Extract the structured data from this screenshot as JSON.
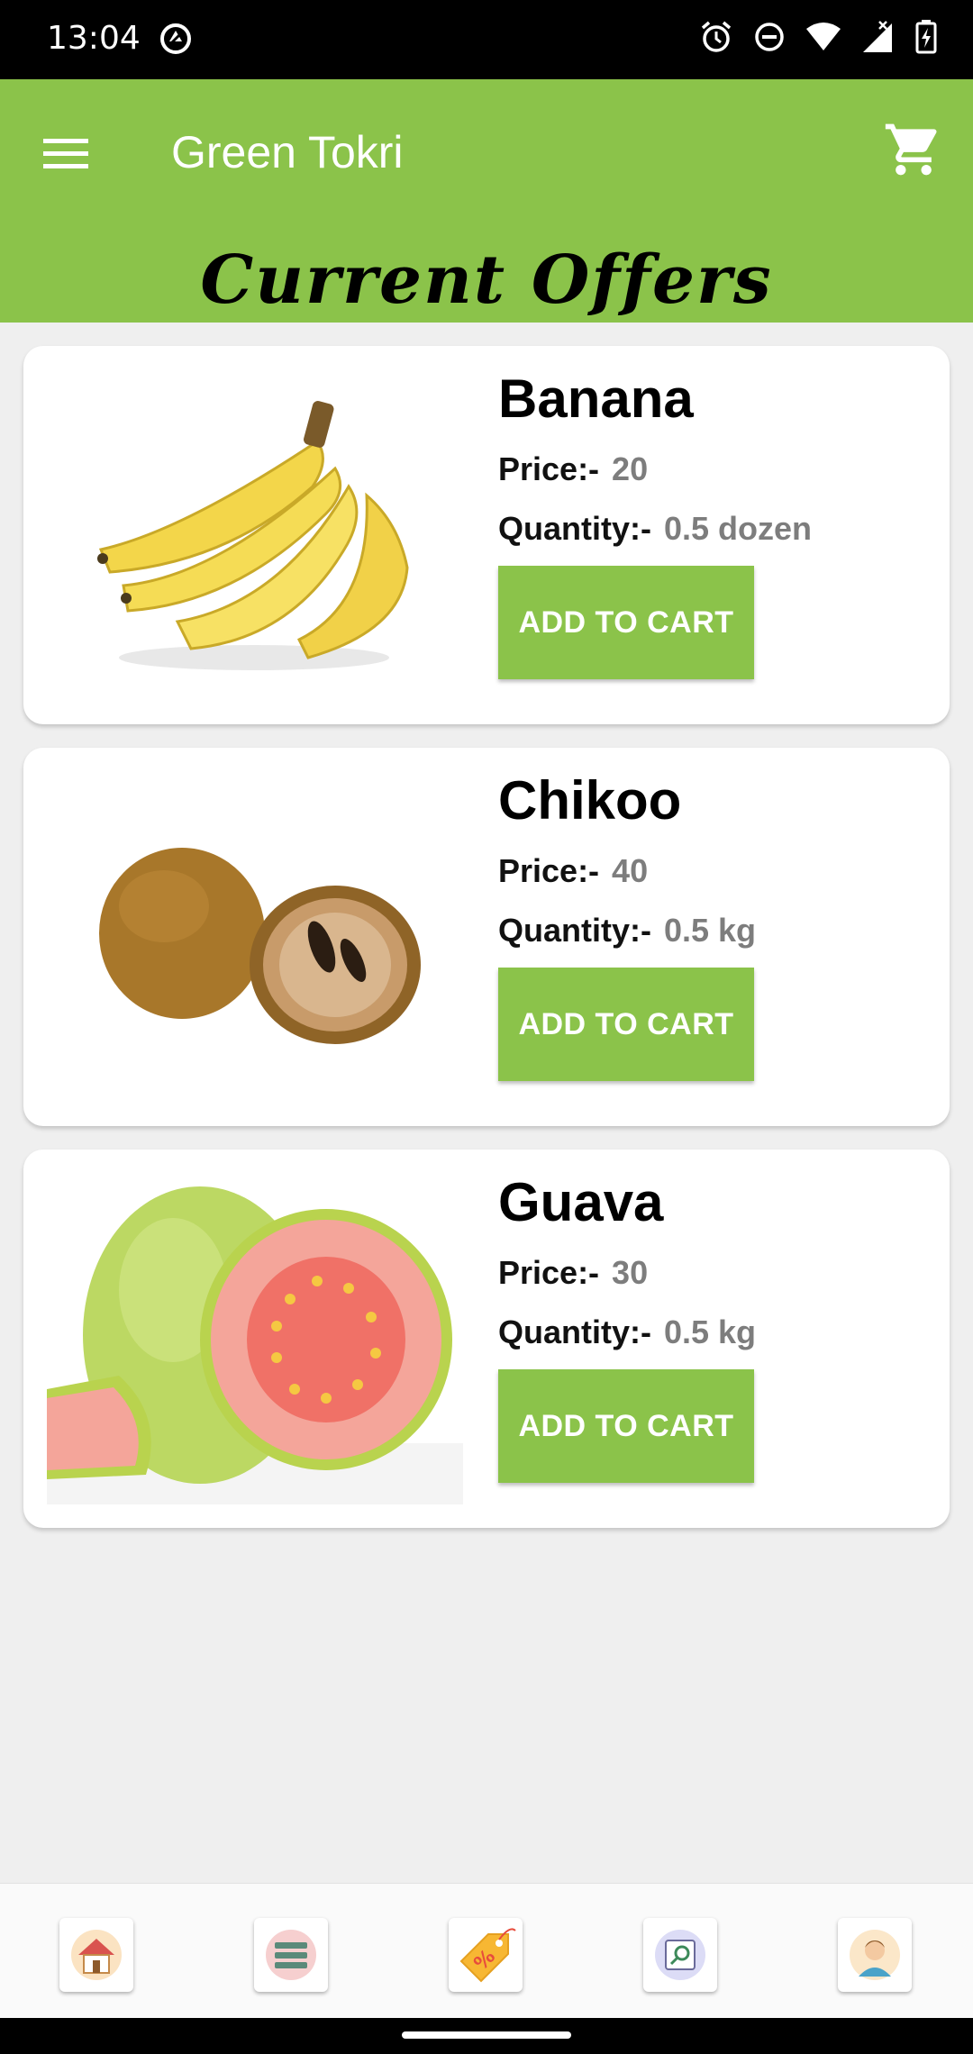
{
  "status_bar": {
    "time": "13:04",
    "icons": [
      "vpn-icon",
      "alarm-icon",
      "dnd-icon",
      "wifi-icon",
      "signal-icon",
      "battery-icon"
    ]
  },
  "app_bar": {
    "title": "Green Tokri",
    "page_title": "Current Offers",
    "accent_color": "#8bc34a",
    "icons": [
      "menu-icon",
      "cart-icon"
    ]
  },
  "products": [
    {
      "name": "Banana",
      "price_label": "Price:-",
      "price": "20",
      "quantity_label": "Quantity:-",
      "quantity": "0.5 dozen",
      "button": "ADD TO CART"
    },
    {
      "name": "Chikoo",
      "price_label": "Price:-",
      "price": "40",
      "quantity_label": "Quantity:-",
      "quantity": "0.5 kg",
      "button": "ADD TO CART"
    },
    {
      "name": "Guava",
      "price_label": "Price:-",
      "price": "30",
      "quantity_label": "Quantity:-",
      "quantity": "0.5 kg",
      "button": "ADD TO CART"
    }
  ],
  "bottom_nav": {
    "items": [
      "home-icon",
      "list-icon",
      "offers-icon",
      "search-icon",
      "profile-icon"
    ]
  }
}
